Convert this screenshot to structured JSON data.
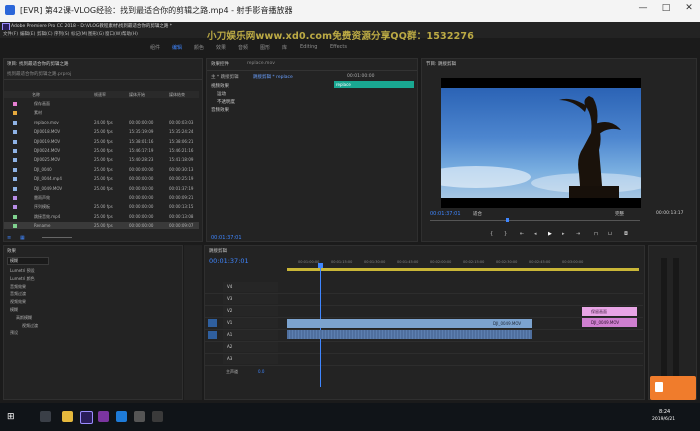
{
  "window": {
    "title": "[EVR] 第42课-VLOG经验：找到最适合你的剪辑之路.mp4 - 射手影音播放器",
    "min": "—",
    "max": "□",
    "close": "✕"
  },
  "premiere": {
    "title": "Adobe Premiere Pro CC 2018 - D:\\VLOG教程素材\\找到最适合你的剪辑之路 *"
  },
  "watermark": "小刀娱乐网www.xd0.com免费资源分享QQ群：1532276",
  "menu": [
    "文件(F)",
    "编辑(E)",
    "剪辑(C)",
    "序列(S)",
    "标记(M)",
    "图形(G)",
    "窗口(W)",
    "帮助(H)"
  ],
  "workspaces": [
    "组件",
    "编辑",
    "颜色",
    "效果",
    "音频",
    "图形",
    "库",
    "Editing",
    "Effects"
  ],
  "project_panel": {
    "tab": "项目: 找到最适合你的剪辑之路",
    "subtitle": "找到最适合你的剪辑之路.prproj",
    "columns": [
      "名称",
      "帧速率",
      "媒体开始",
      "媒体结束"
    ],
    "items": [
      {
        "name": "保存画面",
        "fps": "",
        "start": "",
        "end": "",
        "color": "#e67fd2"
      },
      {
        "name": "素材",
        "fps": "",
        "start": "",
        "end": "",
        "color": "#e6a93d"
      },
      {
        "name": "replace.mov",
        "fps": "24.00 fps",
        "start": "00:00:00:00",
        "end": "00:00:03:03",
        "color": "#8fb3e6"
      },
      {
        "name": "DJI0018.MOV",
        "fps": "25.00 fps",
        "start": "15:35:19:09",
        "end": "15:35:24:24",
        "color": "#8fb3e6"
      },
      {
        "name": "DJI0019.MOV",
        "fps": "25.00 fps",
        "start": "15:38:01:16",
        "end": "15:38:06:21",
        "color": "#8fb3e6"
      },
      {
        "name": "DJI0024.MOV",
        "fps": "25.00 fps",
        "start": "15:46:17:19",
        "end": "15:46:21:16",
        "color": "#8fb3e6"
      },
      {
        "name": "DJI0025.MOV",
        "fps": "25.00 fps",
        "start": "15:40:28:23",
        "end": "15:41:18:09",
        "color": "#8fb3e6"
      },
      {
        "name": "DJI_0040",
        "fps": "25.00 fps",
        "start": "00:00:00:00",
        "end": "00:00:30:13",
        "color": "#8fb3e6"
      },
      {
        "name": "DJI_0044.mp4",
        "fps": "25.00 fps",
        "start": "00:00:00:00",
        "end": "00:00:25:19",
        "color": "#8fb3e6"
      },
      {
        "name": "DJI_0049.MOV",
        "fps": "25.00 fps",
        "start": "00:00:00:00",
        "end": "00:01:37:19",
        "color": "#8fb3e6"
      },
      {
        "name": "雷雨声效",
        "fps": "",
        "start": "00:00:00:00",
        "end": "00:00:09:21",
        "color": "#b78ce6"
      },
      {
        "name": "序列模板",
        "fps": "25.00 fps",
        "start": "00:00:00:00",
        "end": "00:00:13:15",
        "color": "#b78ce6"
      },
      {
        "name": "跳接音效.mp4",
        "fps": "25.00 fps",
        "start": "00:00:00:00",
        "end": "00:00:13:08",
        "color": "#7fd28f"
      },
      {
        "name": "Rename",
        "fps": "25.00 fps",
        "start": "00:00:00:00",
        "end": "00:00:09:07",
        "color": "#7fd28f"
      }
    ]
  },
  "effects_panel": {
    "tab": "效果控件",
    "tab2": "replace.mov",
    "source": "主 * 跳接剪辑",
    "sequence": "跳接剪辑 * replace",
    "time": "00:01:00:00",
    "sections": [
      "视频效果",
      "运动",
      "不透明度",
      "音频效果"
    ],
    "clip": "replace",
    "timecode": "00:01:37:01"
  },
  "program_monitor": {
    "tab": "节目: 跳接剪辑",
    "timecode": "00:01:37:01",
    "fit": "适合",
    "quality": "完整",
    "duration": "00:00:13:17"
  },
  "effects_lib": {
    "tab": "效果",
    "search": "模糊",
    "items": [
      "Lumetri 预设",
      "Lumetri 颜色",
      "音频效果",
      "音频过渡",
      "视频效果",
      "模糊",
      "高斯模糊",
      "视频过渡",
      "预设"
    ]
  },
  "timeline": {
    "tab": "跳接剪辑",
    "timecode": "00:01:37:01",
    "ruler": [
      "00:01:00:00",
      "00:01:15:00",
      "00:01:30:00",
      "00:01:45:00",
      "00:02:00:00",
      "00:02:15:00",
      "00:02:30:00",
      "00:02:45:00",
      "00:03:00:00"
    ],
    "tracks": [
      "V4",
      "V3",
      "V2",
      "V1",
      "A1",
      "A2",
      "A3"
    ],
    "master": "主声道",
    "master_val": "0.0",
    "clip_v1": "DJI_0049.MOV",
    "clip_right1": "保留画面",
    "clip_right2": "DJI_0049.MOV"
  },
  "taskbar": {
    "time": "8:24",
    "date": "2019/6/21"
  }
}
